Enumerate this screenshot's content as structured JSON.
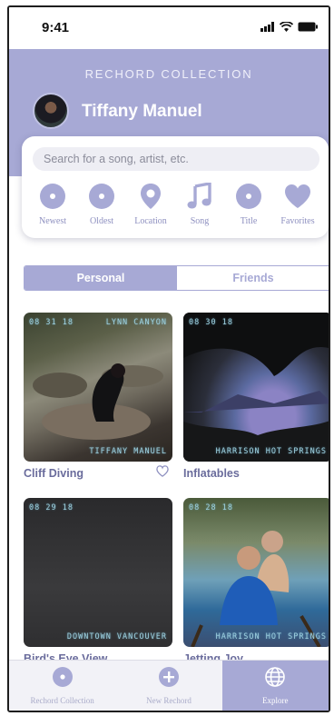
{
  "status": {
    "time": "9:41"
  },
  "header": {
    "title": "RECHORD COLLECTION",
    "user_name": "Tiffany Manuel"
  },
  "search": {
    "placeholder": "Search for a song, artist, etc."
  },
  "filters": [
    {
      "label": "Newest",
      "icon": "disc-icon"
    },
    {
      "label": "Oldest",
      "icon": "disc-icon"
    },
    {
      "label": "Location",
      "icon": "location-pin-icon"
    },
    {
      "label": "Song",
      "icon": "music-note-icon"
    },
    {
      "label": "Title",
      "icon": "disc-icon"
    },
    {
      "label": "Favorites",
      "icon": "heart-icon"
    }
  ],
  "segments": {
    "personal": "Personal",
    "friends": "Friends",
    "active": "personal"
  },
  "cards": [
    {
      "title": "Cliff Diving",
      "date": "08 31 18",
      "location": "LYNN CANYON",
      "owner": "TIFFANY MANUEL"
    },
    {
      "title": "Inflatables",
      "date": "08 30 18",
      "location": "HARRISON HOT SPRINGS"
    },
    {
      "title": "Bird's Eye View",
      "date": "08 29 18",
      "location": "DOWNTOWN VANCOUVER"
    },
    {
      "title": "Jetting Joy",
      "date": "08 28 18",
      "location": "HARRISON HOT SPRINGS"
    }
  ],
  "tabbar": [
    {
      "label": "Rechord Collection",
      "icon": "disc-icon"
    },
    {
      "label": "New Rechord",
      "icon": "plus-icon"
    },
    {
      "label": "Explore",
      "icon": "globe-icon",
      "active": true
    }
  ],
  "colors": {
    "accent": "#a7a9d5",
    "text": "#6a6c9c",
    "icon": "#a7a9d5"
  }
}
